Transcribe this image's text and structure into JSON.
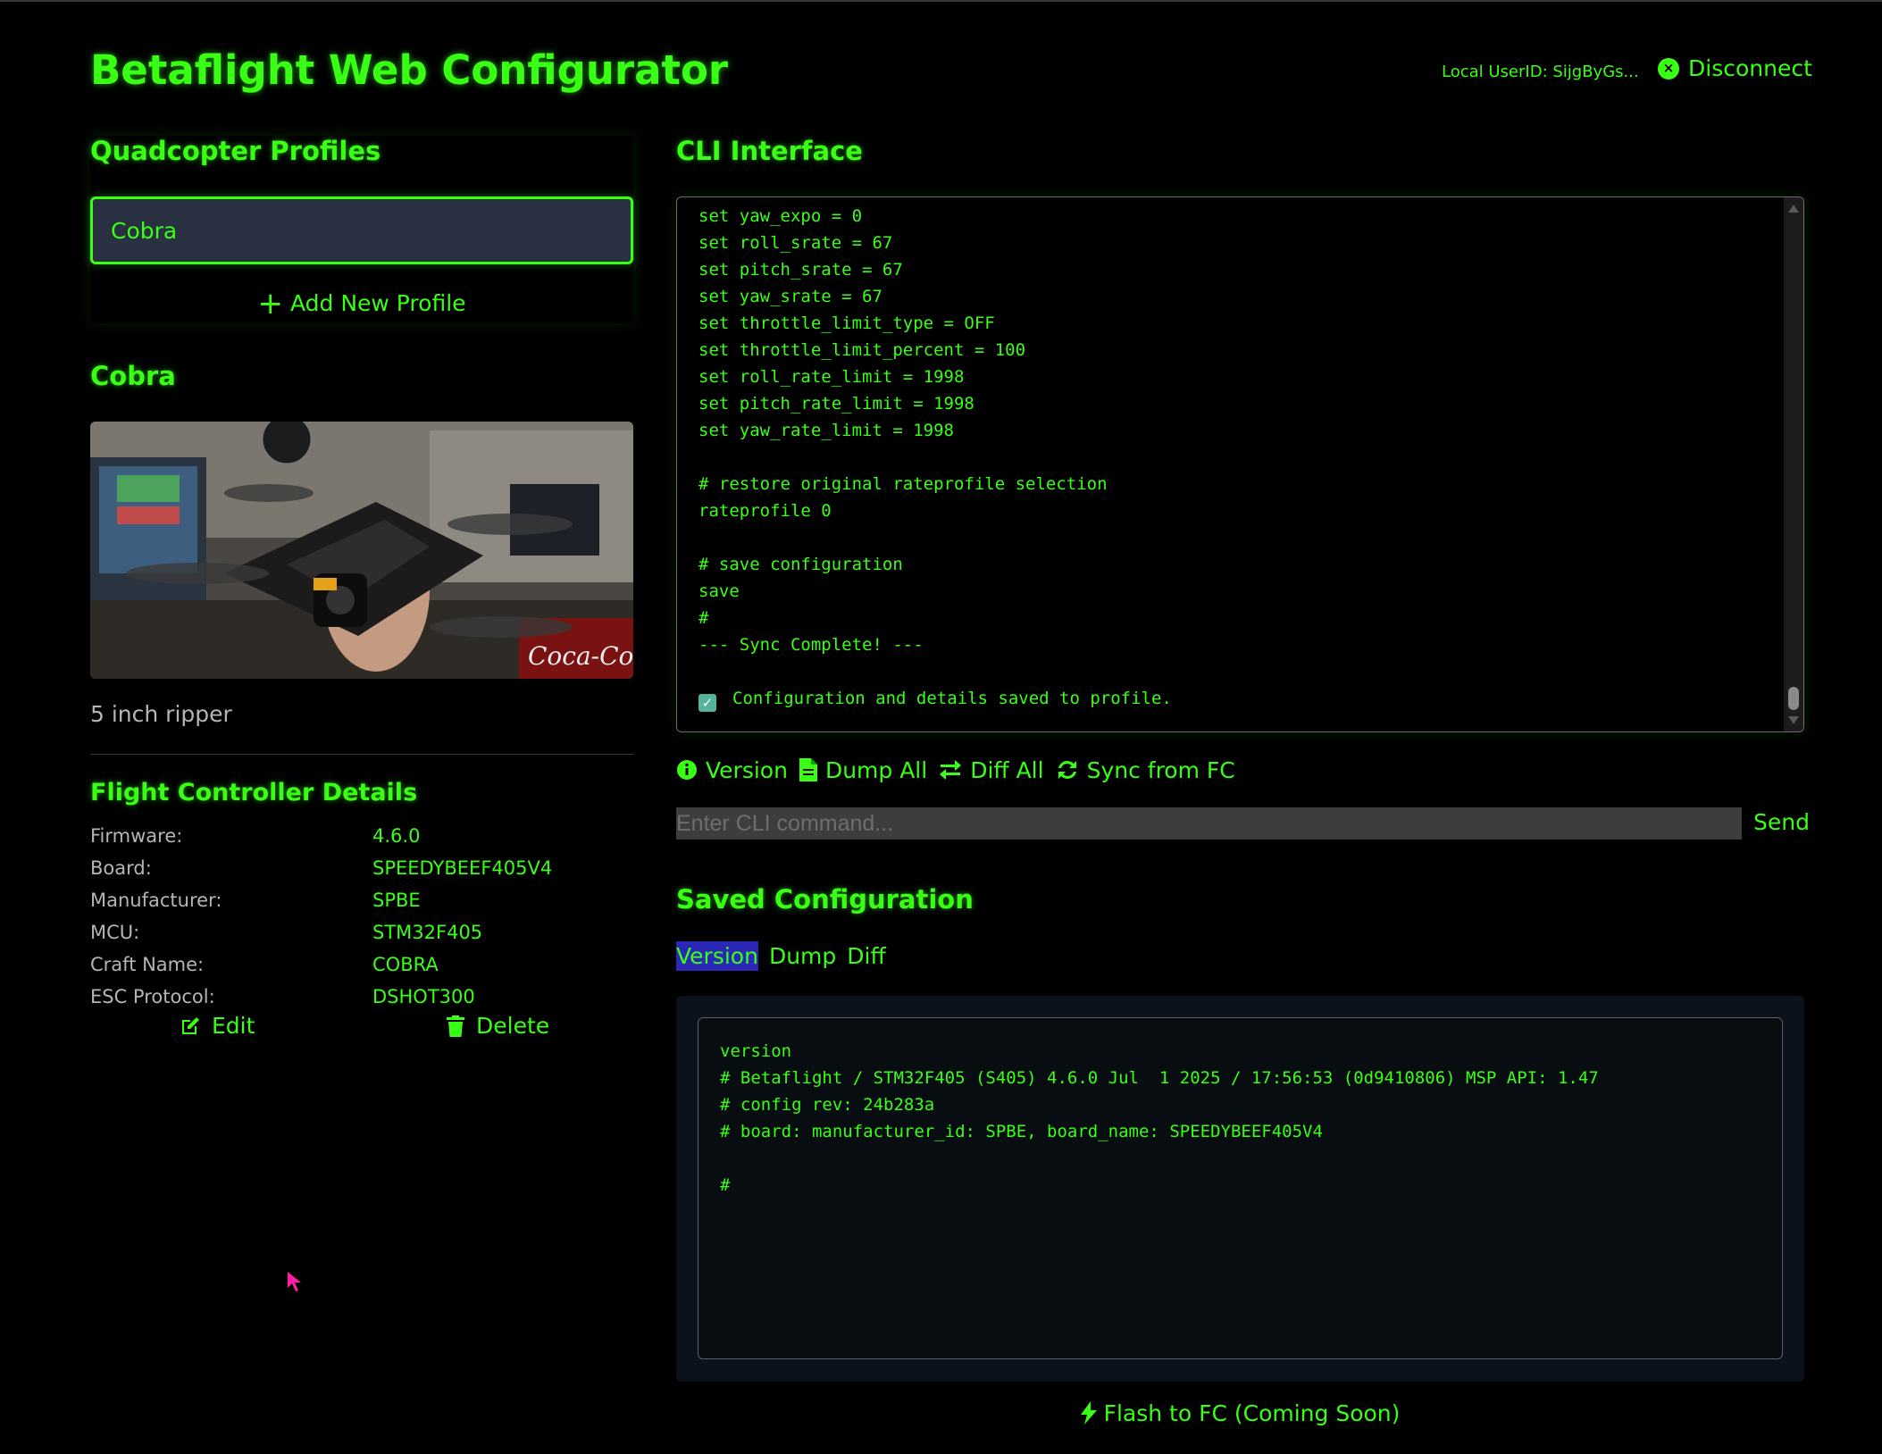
{
  "header": {
    "title": "Betaflight Web Configurator",
    "user_id": "Local UserID: SijgByGs...",
    "disconnect_label": "Disconnect"
  },
  "profiles": {
    "heading": "Quadcopter Profiles",
    "items": [
      {
        "label": "Cobra",
        "selected": true
      }
    ],
    "add_label": "Add New Profile"
  },
  "profile_detail": {
    "name": "Cobra",
    "photo_icon": "drone-photo",
    "description": "5 inch ripper",
    "fc_heading": "Flight Controller Details",
    "fc_rows": [
      {
        "label": "Firmware:",
        "value": "4.6.0"
      },
      {
        "label": "Board:",
        "value": "SPEEDYBEEF405V4"
      },
      {
        "label": "Manufacturer:",
        "value": "SPBE"
      },
      {
        "label": "MCU:",
        "value": "STM32F405"
      },
      {
        "label": "Craft Name:",
        "value": "COBRA"
      },
      {
        "label": "ESC Protocol:",
        "value": "DSHOT300"
      }
    ],
    "edit_label": "Edit",
    "delete_label": "Delete"
  },
  "cli": {
    "heading": "CLI Interface",
    "lines": [
      "set yaw_expo = 0",
      "set roll_srate = 67",
      "set pitch_srate = 67",
      "set yaw_srate = 67",
      "set throttle_limit_type = OFF",
      "set throttle_limit_percent = 100",
      "set roll_rate_limit = 1998",
      "set pitch_rate_limit = 1998",
      "set yaw_rate_limit = 1998",
      "",
      "# restore original rateprofile selection",
      "rateprofile 0",
      "",
      "# save configuration",
      "save",
      "#",
      "--- Sync Complete! ---",
      ""
    ],
    "status_line": "Configuration and details saved to profile.",
    "actions": {
      "version": "Version",
      "dump_all": "Dump All",
      "diff_all": "Diff All",
      "sync": "Sync from FC"
    },
    "input_placeholder": "Enter CLI command...",
    "send_label": "Send"
  },
  "saved": {
    "heading": "Saved Configuration",
    "tabs": [
      "Version",
      "Dump",
      "Diff"
    ],
    "active_tab": "Version",
    "lines": [
      "version",
      "# Betaflight / STM32F405 (S405) 4.6.0 Jul  1 2025 / 17:56:53 (0d9410806) MSP API: 1.47",
      "# config rev: 24b283a",
      "# board: manufacturer_id: SPBE, board_name: SPEEDYBEEF405V4",
      "",
      "#"
    ],
    "flash_label": "Flash to FC (Coming Soon)"
  },
  "colors": {
    "accent": "#39ff14",
    "background": "#000000",
    "profile_bg": "#283042",
    "active_tab_bg": "#2b28b8",
    "cursor": "#ff1fa0"
  }
}
